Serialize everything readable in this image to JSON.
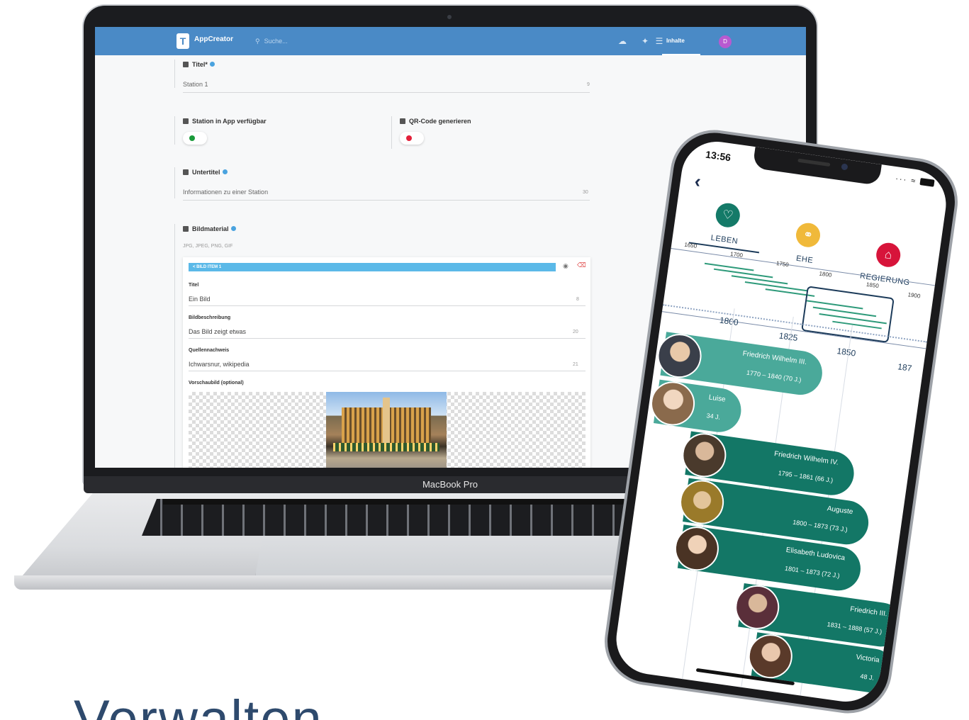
{
  "laptop": {
    "brand_label": "MacBook Pro",
    "app": {
      "name": "AppCreator",
      "search_placeholder": "Suche...",
      "nav": {
        "inhalte_label": "Inhalte",
        "avatar_initial": "D"
      },
      "fields": {
        "titel": {
          "label": "Titel*",
          "value": "Station 1",
          "count": "9"
        },
        "station_available": {
          "label": "Station in App verfügbar",
          "state": "on",
          "color": "#1a9a3a"
        },
        "qr_code": {
          "label": "QR-Code generieren",
          "state": "off",
          "color": "#e3203a"
        },
        "untertitel": {
          "label": "Untertitel",
          "value": "Informationen zu einer Station",
          "count": "30"
        },
        "bildmaterial": {
          "label": "Bildmaterial",
          "hint": "JPG, JPEG, PNG, GIF"
        }
      },
      "image_item": {
        "bar_label": "< BILD ITEM 1",
        "titel_label": "Titel",
        "titel_value": "Ein Bild",
        "titel_count": "8",
        "beschreibung_label": "Bildbeschreibung",
        "beschreibung_value": "Das Bild zeigt etwas",
        "beschreibung_count": "20",
        "quelle_label": "Quellennachweis",
        "quelle_value": "Ichwarsnur, wikipedia",
        "quelle_count": "21",
        "vorschau_label": "Vorschaubild (optional)"
      }
    }
  },
  "phone": {
    "status_time": "13:56",
    "categories": [
      {
        "name": "LEBEN",
        "icon": "heart-icon",
        "color": "#147a68"
      },
      {
        "name": "EHE",
        "icon": "rings-icon",
        "color": "#f0b93a"
      },
      {
        "name": "REGIERUNG",
        "icon": "building-icon",
        "color": "#d7143a"
      }
    ],
    "timeline_years_small": [
      "1650",
      "1700",
      "1750",
      "1800",
      "1850",
      "1900"
    ],
    "timeline_years_big": [
      "1800",
      "1825",
      "1850",
      "187"
    ],
    "persons": [
      {
        "name": "Friedrich Wilhelm III.",
        "years": "1770 – 1840 (70 J.)"
      },
      {
        "name": "Luise",
        "years": "34 J."
      },
      {
        "name": "Friedrich Wilhelm IV.",
        "years": "1795 – 1861 (66 J.)"
      },
      {
        "name": "Auguste",
        "years": "1800 – 1873 (73 J.)"
      },
      {
        "name": "Elisabeth Ludovica",
        "years": "1801 – 1873 (72 J.)"
      },
      {
        "name": "Friedrich III.",
        "years": "1831 – 1888 (57 J.)"
      },
      {
        "name": "Victoria",
        "years": "48 J."
      }
    ],
    "accent_light": "#4aa99a",
    "accent_dark": "#137766"
  },
  "headline": "Verwalten"
}
